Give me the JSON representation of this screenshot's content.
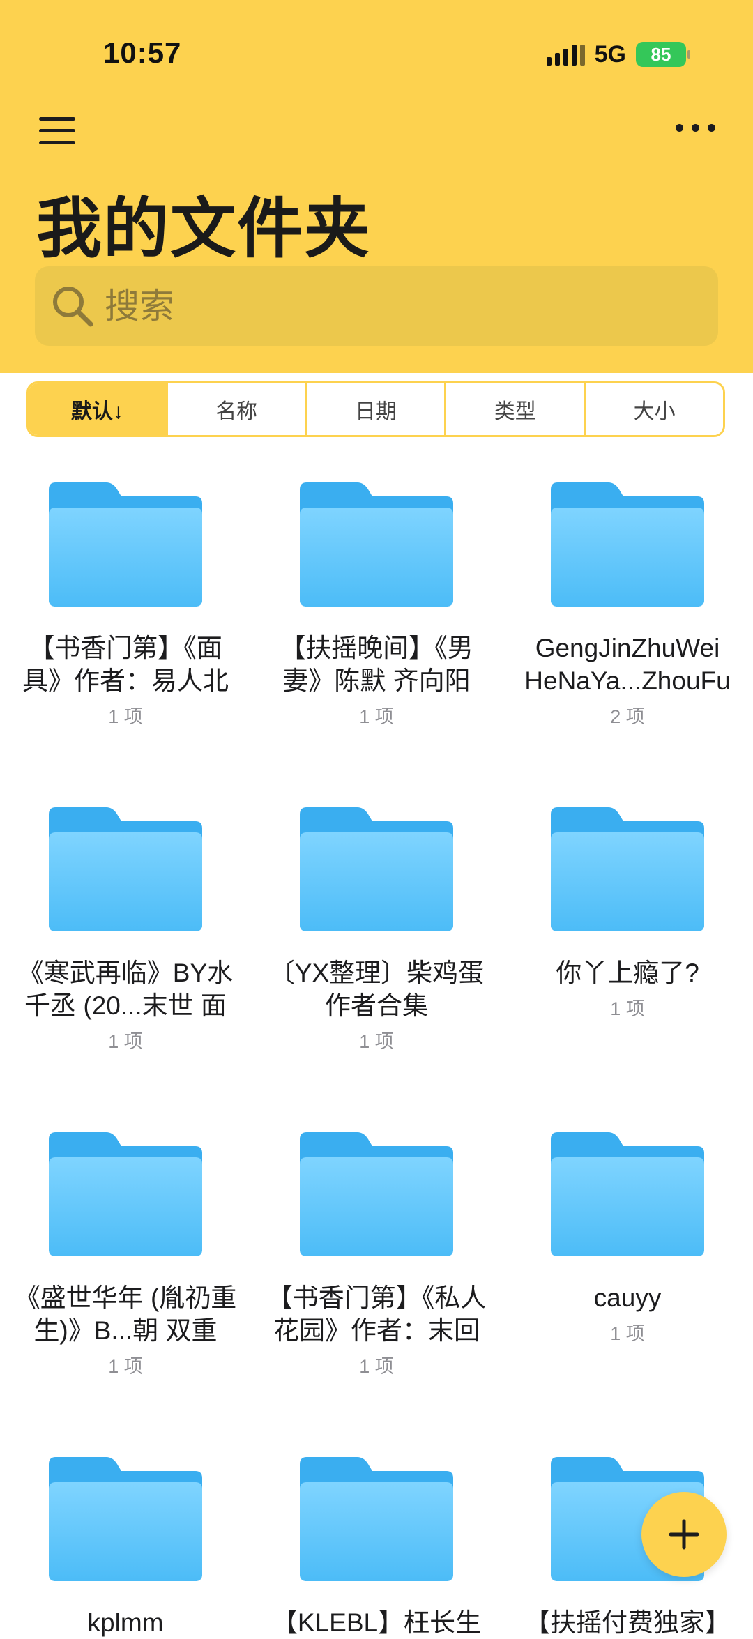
{
  "status": {
    "time": "10:57",
    "network": "5G",
    "battery": "85"
  },
  "header": {
    "title": "我的文件夹"
  },
  "search": {
    "placeholder": "搜索"
  },
  "sort": {
    "tabs": [
      "默认↓",
      "名称",
      "日期",
      "类型",
      "大小"
    ]
  },
  "folders": [
    {
      "name": "【书香门第】《面具》作者：易人北",
      "count": "1 项"
    },
    {
      "name": "【扶摇晚间】《男妻》陈默 齐向阳",
      "count": "1 项"
    },
    {
      "name": "GengJinZhuWei HeNaYa...ZhouFu",
      "count": "2 项"
    },
    {
      "name": "《寒武再临》BY水千丞 (20...末世 面",
      "count": "1 项"
    },
    {
      "name": "〔YX整理〕柴鸡蛋作者合集",
      "count": "1 项"
    },
    {
      "name": "你丫上瘾了?",
      "count": "1 项"
    },
    {
      "name": "《盛世华年 (胤礽重生)》B...朝 双重",
      "count": "1 项"
    },
    {
      "name": "【书香门第】《私人花园》作者：末回",
      "count": "1 项"
    },
    {
      "name": "cauyy",
      "count": "1 项"
    },
    {
      "name": "kplmm",
      "count": ""
    },
    {
      "name": "【KLEBL】枉长生",
      "count": ""
    },
    {
      "name": "【扶摇付费独家】",
      "count": ""
    }
  ],
  "colors": {
    "accent": "#fdd24f",
    "folder": "#5ac8fa"
  }
}
